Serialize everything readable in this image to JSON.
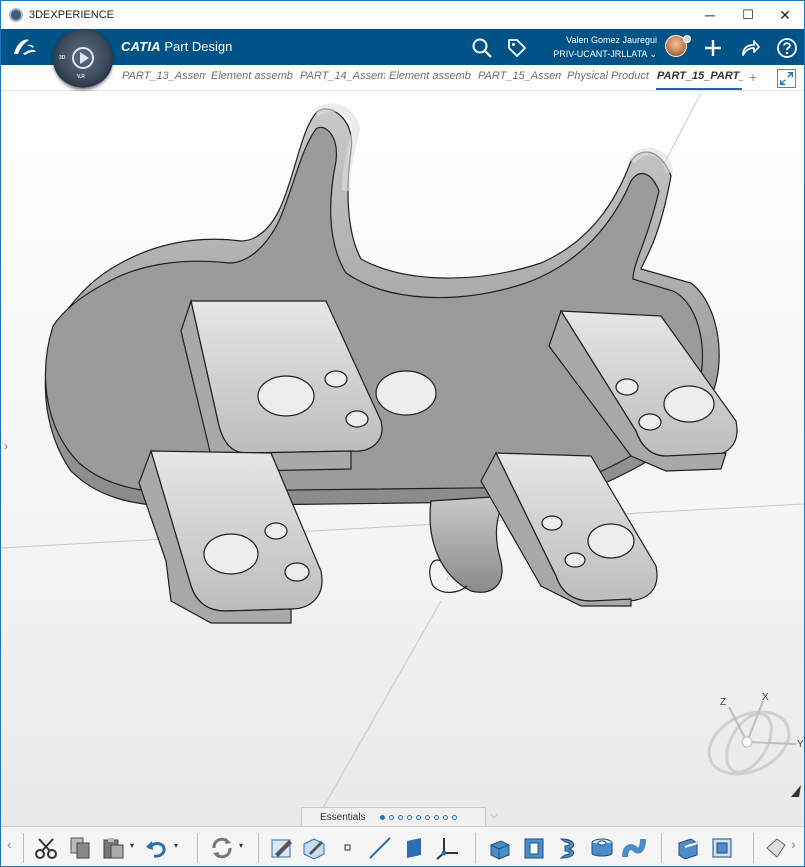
{
  "window": {
    "title": "3DEXPERIENCE",
    "controls": {
      "minimize": "─",
      "maximize": "☐",
      "close": "✕"
    }
  },
  "appbar": {
    "brand_bold": "CATIA",
    "brand_app": "Part Design",
    "compass": {
      "center_label": "V.R",
      "left_label": "3D"
    },
    "user": {
      "name": "Valen Gomez Jauregui",
      "tenant": "PRIV-UCANT-JRLLATA"
    }
  },
  "tabs": [
    {
      "label": "PART_13_Assem"
    },
    {
      "label": "Element assemb"
    },
    {
      "label": "PART_14_Assem"
    },
    {
      "label": "Element assemb"
    },
    {
      "label": "PART_15_Assem"
    },
    {
      "label": "Physical Product"
    },
    {
      "label": "PART_15_PART_"
    }
  ],
  "tab_add": "+",
  "viewport": {
    "left_expander": "›",
    "triad": {
      "x": "X",
      "y": "Y",
      "z": "Z"
    }
  },
  "section_bar": {
    "label": "Essentials",
    "pages": 9,
    "active_page": 0
  },
  "action_bar": {
    "nav_left": "‹",
    "nav_right": "›",
    "groups": [
      [
        "cut-icon",
        "copy-icon",
        "paste-icon",
        "undo-icon"
      ],
      [
        "update-icon"
      ],
      [
        "sketch-icon",
        "positioned-sketch-icon",
        "point-icon",
        "line-icon",
        "plane-icon",
        "axis-system-icon"
      ],
      [
        "pad-icon",
        "pocket-icon",
        "shaft-icon",
        "hole-icon",
        "rib-icon"
      ],
      [
        "fillet-icon",
        "chamfer-icon"
      ]
    ]
  },
  "colors": {
    "header_blue": "#005386",
    "accent": "#1b6fa8"
  }
}
